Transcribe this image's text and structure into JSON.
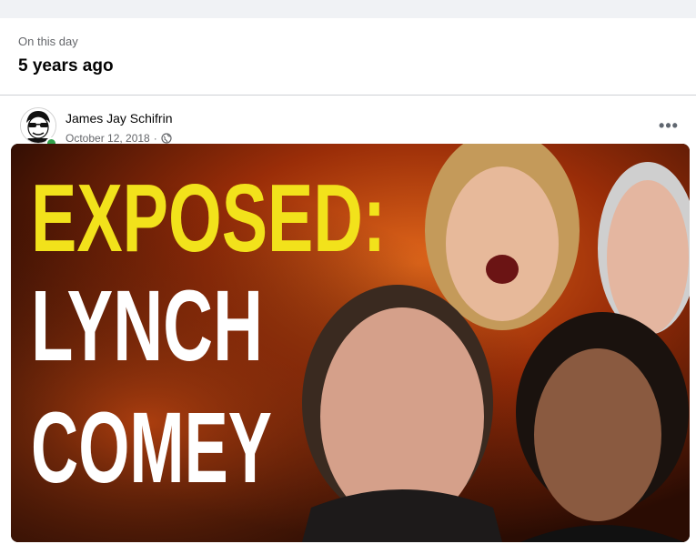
{
  "memory": {
    "label": "On this day",
    "title": "5 years ago"
  },
  "post": {
    "author": "James Jay Schifrin",
    "date": "October 12, 2018",
    "separator": "·",
    "privacy_icon": "globe-icon",
    "more_icon": "ellipsis-icon",
    "more_label": "•••",
    "image": {
      "headline_1": "EXPOSED:",
      "headline_2": "LYNCH",
      "headline_3": "COMEY",
      "colors": {
        "yellow_text": "#f2e21b",
        "white_text": "#ffffff",
        "fire": "#c2410c"
      }
    }
  },
  "status": {
    "online": true,
    "online_color": "#31a24c"
  }
}
